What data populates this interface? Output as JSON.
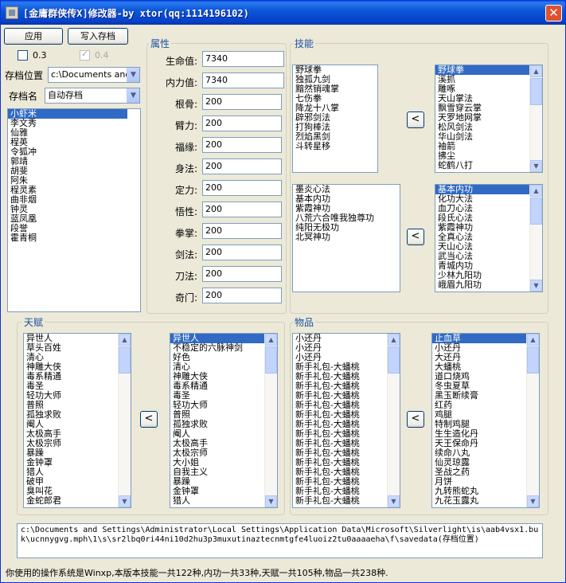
{
  "window": {
    "title": "[金庸群侠传X]修改器-by xtor(qq:1114196102)",
    "close_glyph": "✕"
  },
  "toolbar": {
    "apply_label": "应用",
    "write_save_label": "写入存档"
  },
  "version_options": {
    "v03_label": "0.3",
    "v03_checked": false,
    "v04_label": "0.4",
    "v04_checked": true,
    "v04_disabled": true
  },
  "save_location": {
    "label": "存档位置",
    "value": "c:\\Documents and"
  },
  "save_name": {
    "label": "存档名",
    "value": "自动存档"
  },
  "characters": {
    "items": [
      "小虾米",
      "李文秀",
      "仙雅",
      "程英",
      "令狐冲",
      "郭靖",
      "胡斐",
      "阿朱",
      "程灵素",
      "曲非烟",
      "钟灵",
      "蓝凤凰",
      "段誉",
      "霍青桐"
    ],
    "selected_index": 0
  },
  "attributes": {
    "title": "属性",
    "fields": [
      {
        "label": "生命值:",
        "value": "7340"
      },
      {
        "label": "内力值:",
        "value": "7340"
      },
      {
        "label": "根骨:",
        "value": "200"
      },
      {
        "label": "臂力:",
        "value": "200"
      },
      {
        "label": "福缘:",
        "value": "200"
      },
      {
        "label": "身法:",
        "value": "200"
      },
      {
        "label": "定力:",
        "value": "200"
      },
      {
        "label": "悟性:",
        "value": "200"
      },
      {
        "label": "拳掌:",
        "value": "200"
      },
      {
        "label": "剑法:",
        "value": "200"
      },
      {
        "label": "刀法:",
        "value": "200"
      },
      {
        "label": "奇门:",
        "value": "200"
      }
    ]
  },
  "skills": {
    "title": "技能",
    "owned_skills": [
      "野球拳",
      "独孤九剑",
      "黯然销魂掌",
      "七伤拳",
      "降龙十八掌",
      "辟邪剑法",
      "打狗棒法",
      "烈焰黑剑",
      "斗转星移"
    ],
    "all_skills": [
      "野球拳",
      "溪抓",
      "雕啄",
      "天山掌法",
      "飘雪穿云掌",
      "天罗地网掌",
      "松风剑法",
      "华山剑法",
      "袖箭",
      "拂尘",
      "蛇鹤八打"
    ],
    "all_skills_selected_index": 0,
    "owned_internal": [
      "墨炎心法",
      "基本内功",
      "紫霞神功",
      "八荒六合唯我独尊功",
      "纯阳无极功",
      "北冥神功"
    ],
    "all_internal": [
      "基本内功",
      "化功大法",
      "血刀心法",
      "段氏心法",
      "紫霞神功",
      "全真心法",
      "天山心法",
      "武当心法",
      "青城内功",
      "少林九阳功",
      "峨眉九阳功"
    ],
    "all_internal_selected_index": 0,
    "add_glyph": "<"
  },
  "talents": {
    "title": "天赋",
    "owned": [
      "异世人",
      "草头百姓",
      "清心",
      "神雕大侠",
      "毒系精通",
      "毒圣",
      "轻功大师",
      "普照",
      "孤独求败",
      "阉人",
      "太极高手",
      "太极宗师",
      "暴躁",
      "金钟罩",
      "猎人",
      "破甲",
      "臭叫花",
      "金蛇郎君"
    ],
    "all": [
      "异世人",
      "不稳定的六脉神剑",
      "好色",
      "清心",
      "神雕大侠",
      "毒系精通",
      "毒圣",
      "轻功大师",
      "普照",
      "孤独求败",
      "阉人",
      "太极高手",
      "太极宗师",
      "大小姐",
      "自我主义",
      "暴躁",
      "金钟罩",
      "猎人"
    ],
    "all_selected_index": 0,
    "add_glyph": "<"
  },
  "items": {
    "title": "物品",
    "owned": [
      "小还丹",
      "小还丹",
      "小还丹",
      "新手礼包-大蟠桃",
      "新手礼包-大蟠桃",
      "新手礼包-大蟠桃",
      "新手礼包-大蟠桃",
      "新手礼包-大蟠桃",
      "新手礼包-大蟠桃",
      "新手礼包-大蟠桃",
      "新手礼包-大蟠桃",
      "新手礼包-大蟠桃",
      "新手礼包-大蟠桃",
      "新手礼包-大蟠桃",
      "新手礼包-大蟠桃",
      "新手礼包-大蟠桃",
      "新手礼包-大蟠桃",
      "新手礼包-大蟠桃"
    ],
    "all": [
      "止血草",
      "小还丹",
      "大还丹",
      "大蟠桃",
      "道口烧鸡",
      "冬虫夏草",
      "黑玉断续膏",
      "红药",
      "鸡腿",
      "特制鸡腿",
      "生生造化丹",
      "天王保命丹",
      "续命八丸",
      "仙灵琼露",
      "圣战之药",
      "月饼",
      "九转熊蛇丸",
      "九花玉露丸"
    ],
    "all_selected_index": 0,
    "add_glyph": "<"
  },
  "path_display": "c:\\Documents and Settings\\Administrator\\Local Settings\\Application Data\\Microsoft\\Silverlight\\is\\aab4vsx1.buk\\ucnnygvg.mph\\1\\s\\sr2lbq0ri44ni10d2hu3p3muxutinaztecnmtgfe4luoiz2tu0aaaaeha\\f\\savedata(存档位置)",
  "status_text": "你使用的操作系统是Winxp,本版本技能一共122种,内功一共33种,天赋一共105种,物品一共238种."
}
